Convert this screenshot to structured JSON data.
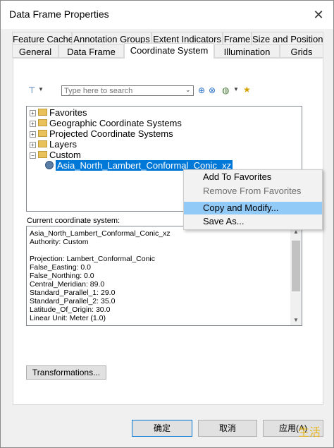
{
  "window": {
    "title": "Data Frame Properties",
    "close": "✕"
  },
  "tabs_row1": [
    "Feature Cache",
    "Annotation Groups",
    "Extent Indicators",
    "Frame",
    "Size and Position"
  ],
  "tabs_row2": [
    "General",
    "Data Frame",
    "Coordinate System",
    "Illumination",
    "Grids"
  ],
  "active_tab": "Coordinate System",
  "toolbar": {
    "filter_icon": "filter-icon",
    "search_placeholder": "Type here to search"
  },
  "tree": {
    "items": [
      "Favorites",
      "Geographic Coordinate Systems",
      "Projected Coordinate Systems",
      "Layers",
      "Custom"
    ],
    "expanders": [
      "+",
      "+",
      "+",
      "+",
      "−"
    ],
    "selected": "Asia_North_Lambert_Conformal_Conic_xz"
  },
  "context_menu": {
    "items": [
      "Add To Favorites",
      "Remove From Favorites",
      "Copy and Modify...",
      "Save As..."
    ]
  },
  "current_cs": {
    "label": "Current coordinate system:",
    "lines": [
      "Asia_North_Lambert_Conformal_Conic_xz",
      "Authority: Custom",
      "",
      "Projection: Lambert_Conformal_Conic",
      "False_Easting: 0.0",
      "False_Northing: 0.0",
      "Central_Meridian: 89.0",
      "Standard_Parallel_1: 29.0",
      "Standard_Parallel_2: 35.0",
      "Latitude_Of_Origin: 30.0",
      "Linear Unit: Meter (1.0)"
    ]
  },
  "buttons": {
    "transformations": "Transformations...",
    "ok": "确定",
    "cancel": "取消",
    "apply": "应用(A)"
  },
  "watermark": "生活"
}
